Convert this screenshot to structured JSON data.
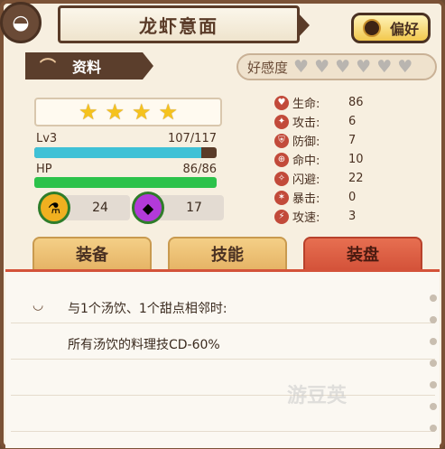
{
  "header": {
    "title": "龙虾意面",
    "favorite_label": "偏好"
  },
  "info_tab": {
    "label": "资料"
  },
  "affection": {
    "label": "好感度",
    "hearts_filled": 0,
    "hearts_total": 6
  },
  "rarity_stars": 4,
  "level": {
    "label": "Lv3",
    "value": "107/117",
    "progress": 0.915
  },
  "hp": {
    "label": "HP",
    "value": "86/86",
    "progress": 1.0
  },
  "items": [
    {
      "count": "24",
      "icon": "potion-icon"
    },
    {
      "count": "17",
      "icon": "gem-icon"
    }
  ],
  "attributes": [
    {
      "name": "生命:",
      "value": "86",
      "icon": "heart-icon"
    },
    {
      "name": "攻击:",
      "value": "6",
      "icon": "attack-icon"
    },
    {
      "name": "防御:",
      "value": "7",
      "icon": "defense-icon"
    },
    {
      "name": "命中:",
      "value": "10",
      "icon": "target-icon"
    },
    {
      "name": "闪避:",
      "value": "22",
      "icon": "dodge-icon"
    },
    {
      "name": "暴击:",
      "value": "0",
      "icon": "crit-icon"
    },
    {
      "name": "攻速:",
      "value": "3",
      "icon": "speed-icon"
    }
  ],
  "tabs": [
    {
      "label": "装备",
      "active": false
    },
    {
      "label": "技能",
      "active": false
    },
    {
      "label": "装盘",
      "active": true
    }
  ],
  "skill": {
    "line1": "与1个汤饮、1个甜点相邻时:",
    "line2": "所有汤饮的料理技CD-60%"
  },
  "watermark": "游豆英",
  "colors": {
    "exp_bar": "#3fc1d6",
    "hp_bar": "#2cc24a",
    "active_tab": "#e76f51",
    "inactive_tab": "#f4cf86"
  }
}
